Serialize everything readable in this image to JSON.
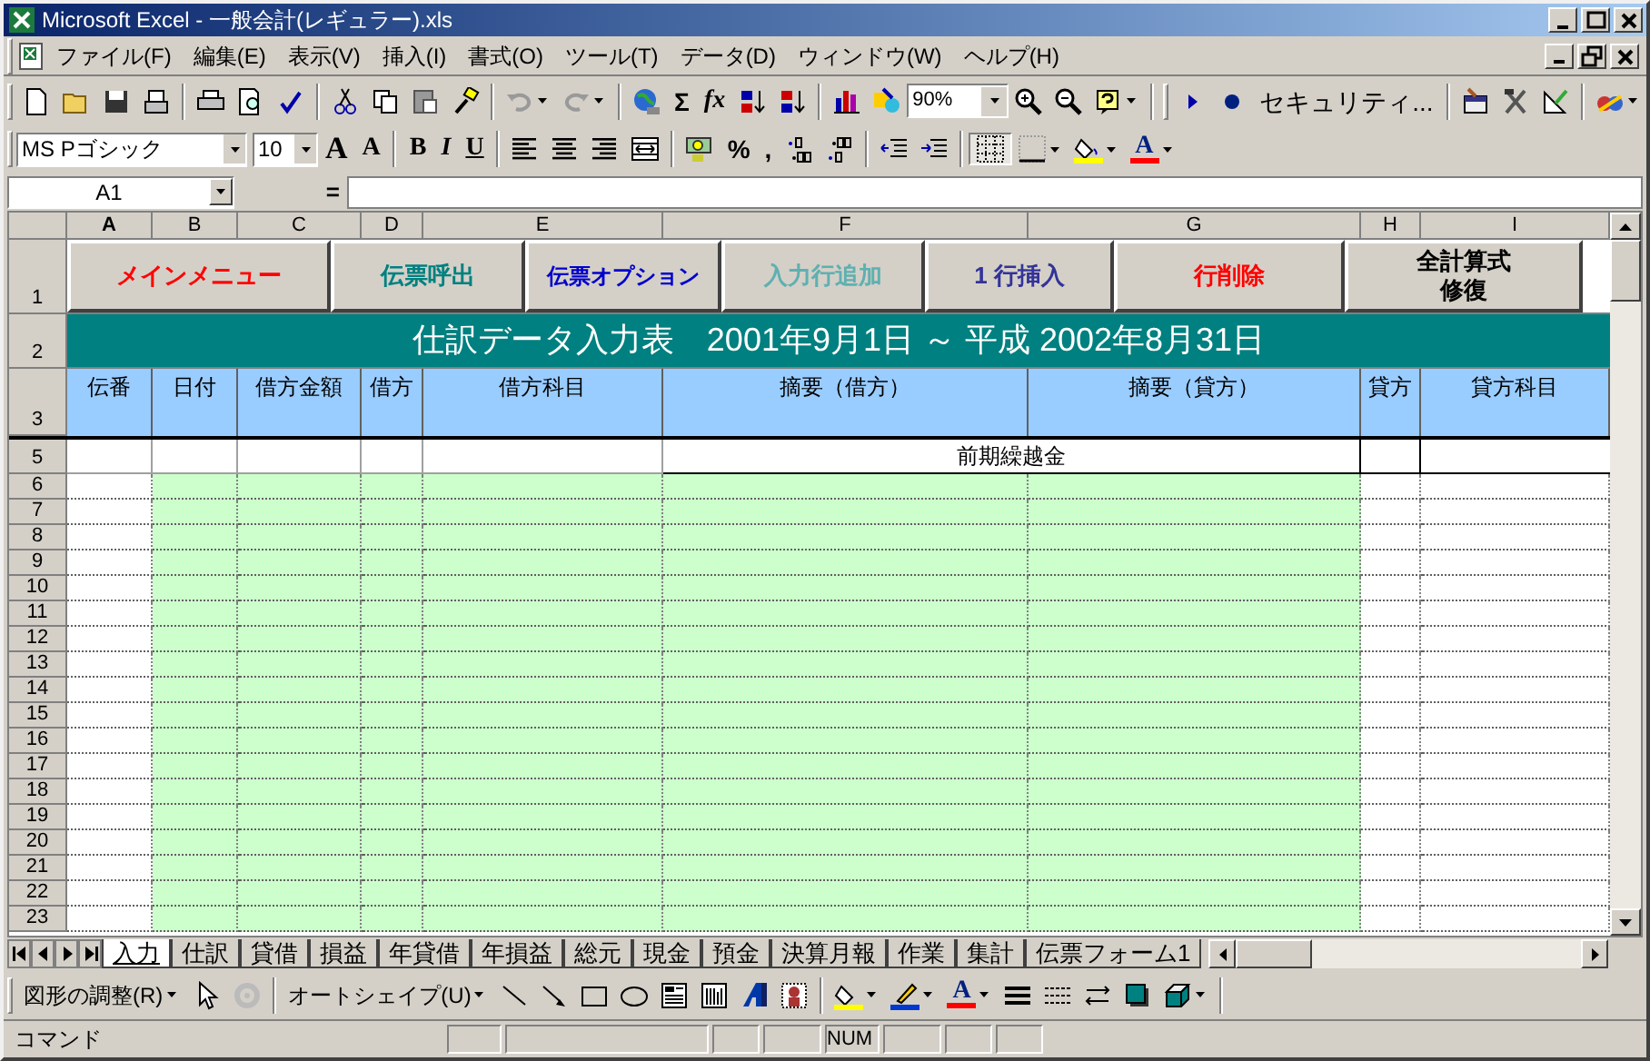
{
  "window": {
    "title": "Microsoft Excel - 一般会計(レギュラー).xls"
  },
  "menu": [
    "ファイル(F)",
    "編集(E)",
    "表示(V)",
    "挿入(I)",
    "書式(O)",
    "ツール(T)",
    "データ(D)",
    "ウィンドウ(W)",
    "ヘルプ(H)"
  ],
  "standard_toolbar": {
    "sum": "Σ",
    "function": "fx",
    "zoom": "90%",
    "security": "セキュリティ..."
  },
  "formatting_toolbar": {
    "font": "MS Pゴシック",
    "size": "10",
    "grow_font": "A",
    "shrink_font": "A",
    "bold": "B",
    "italic": "I",
    "underline": "U",
    "percent": "%",
    "comma": ",",
    "font_color": "A"
  },
  "formula_bar": {
    "name_box": "A1",
    "equals": "="
  },
  "columns": [
    "A",
    "B",
    "C",
    "D",
    "E",
    "F",
    "G",
    "H",
    "I"
  ],
  "row_numbers": [
    "1",
    "2",
    "3",
    "5",
    "6",
    "7",
    "8",
    "9",
    "10",
    "11",
    "12",
    "13",
    "14",
    "15",
    "16",
    "17",
    "18",
    "19",
    "20",
    "21",
    "22",
    "23"
  ],
  "sheet_buttons": [
    {
      "label": "メインメニュー",
      "color": "#ff0000"
    },
    {
      "label": "伝票呼出",
      "color": "#008080"
    },
    {
      "label": "伝票オプション",
      "color": "#0000cc"
    },
    {
      "label": "入力行追加",
      "color": "#5fb0b0"
    },
    {
      "label": "1 行挿入",
      "color": "#333399"
    },
    {
      "label": "行削除",
      "color": "#ff0000"
    },
    {
      "label": "全計算式修復",
      "color": "#000000"
    }
  ],
  "sheet_title": "仕訳データ入力表　2001年9月1日 ～ 平成 2002年8月31日",
  "headers": [
    "伝番",
    "日付",
    "借方金額",
    "借方",
    "借方科目",
    "摘要（借方）",
    "摘要（貸方）",
    "貸方",
    "貸方科目"
  ],
  "row5_text": "前期繰越金",
  "sheet_tabs": [
    {
      "label": "入力",
      "selected": true
    },
    {
      "label": "仕訳",
      "selected": false
    },
    {
      "label": "貸借",
      "selected": false
    },
    {
      "label": "損益",
      "selected": false
    },
    {
      "label": "年貸借",
      "selected": false
    },
    {
      "label": "年損益",
      "selected": false
    },
    {
      "label": "総元",
      "selected": false
    },
    {
      "label": "現金",
      "selected": false
    },
    {
      "label": "預金",
      "selected": false
    },
    {
      "label": "決算月報",
      "selected": false
    },
    {
      "label": "作業",
      "selected": false
    },
    {
      "label": "集計",
      "selected": false
    },
    {
      "label": "伝票フォーム1",
      "selected": false
    }
  ],
  "drawing_toolbar": {
    "arrange": "図形の調整(R)",
    "autoshapes": "オートシェイプ(U)",
    "font_color": "A"
  },
  "status_bar": {
    "mode": "コマンド",
    "num": "NUM"
  }
}
